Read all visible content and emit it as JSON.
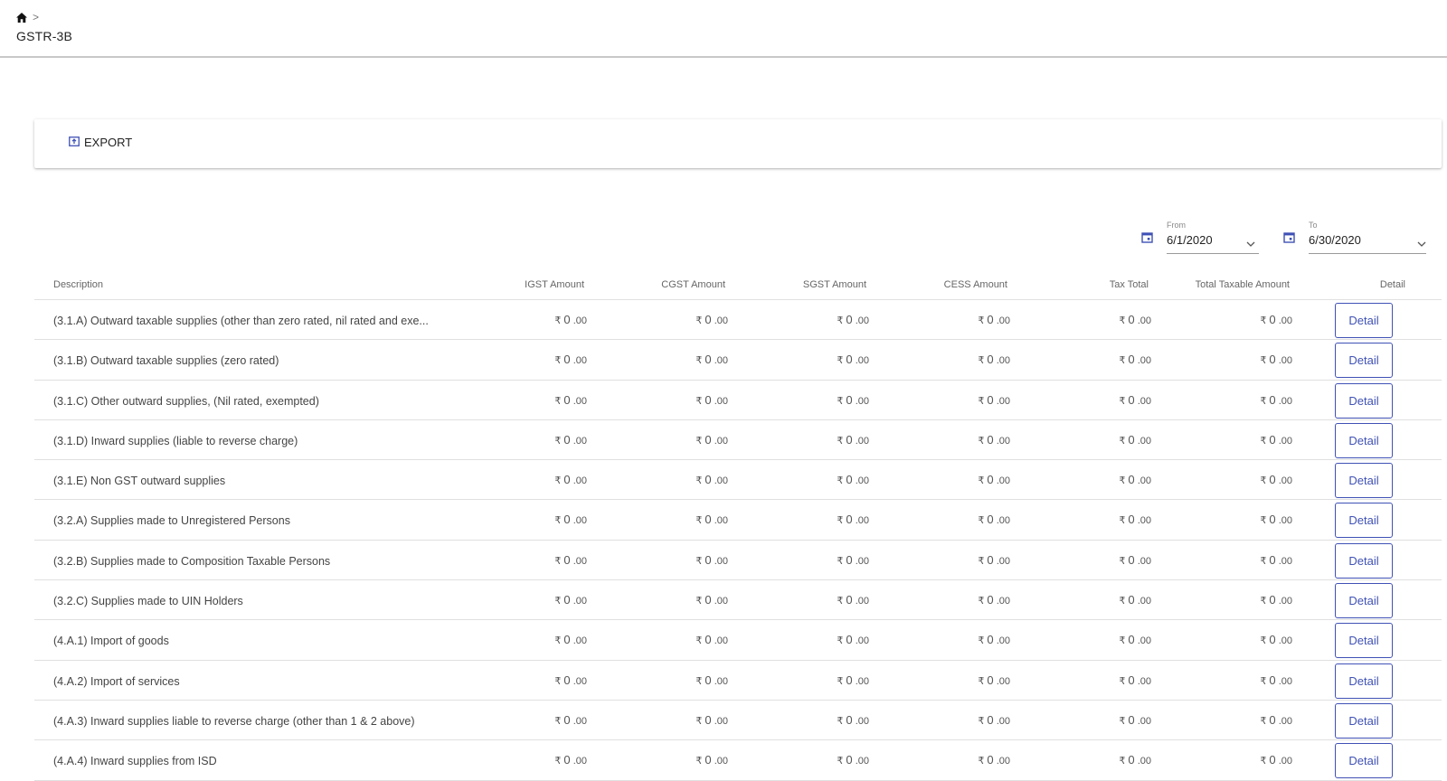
{
  "breadcrumb": {
    "separator": ">",
    "home_icon": "home-icon"
  },
  "page_title": "GSTR-3B",
  "toolbar": {
    "export_label": "EXPORT",
    "export_icon": "export-icon"
  },
  "filters": {
    "from": {
      "label": "From",
      "value": "6/1/2020"
    },
    "to": {
      "label": "To",
      "value": "6/30/2020"
    }
  },
  "table": {
    "columns": [
      "Description",
      "IGST Amount",
      "CGST Amount",
      "SGST Amount",
      "CESS Amount",
      "Tax Total",
      "Total Taxable Amount",
      "Detail"
    ],
    "currency_symbol": "₹",
    "detail_label": "Detail",
    "rows": [
      {
        "description": "(3.1.A) Outward taxable supplies (other than zero rated, nil rated and exe...",
        "amounts": [
          [
            "0",
            ".00"
          ],
          [
            "0",
            ".00"
          ],
          [
            "0",
            ".00"
          ],
          [
            "0",
            ".00"
          ],
          [
            "0",
            ".00"
          ],
          [
            "0",
            ".00"
          ]
        ]
      },
      {
        "description": "(3.1.B) Outward taxable supplies (zero rated)",
        "amounts": [
          [
            "0",
            ".00"
          ],
          [
            "0",
            ".00"
          ],
          [
            "0",
            ".00"
          ],
          [
            "0",
            ".00"
          ],
          [
            "0",
            ".00"
          ],
          [
            "0",
            ".00"
          ]
        ]
      },
      {
        "description": "(3.1.C) Other outward supplies, (Nil rated, exempted)",
        "amounts": [
          [
            "0",
            ".00"
          ],
          [
            "0",
            ".00"
          ],
          [
            "0",
            ".00"
          ],
          [
            "0",
            ".00"
          ],
          [
            "0",
            ".00"
          ],
          [
            "0",
            ".00"
          ]
        ]
      },
      {
        "description": "(3.1.D) Inward supplies (liable to reverse charge)",
        "amounts": [
          [
            "0",
            ".00"
          ],
          [
            "0",
            ".00"
          ],
          [
            "0",
            ".00"
          ],
          [
            "0",
            ".00"
          ],
          [
            "0",
            ".00"
          ],
          [
            "0",
            ".00"
          ]
        ]
      },
      {
        "description": "(3.1.E) Non GST outward supplies",
        "amounts": [
          [
            "0",
            ".00"
          ],
          [
            "0",
            ".00"
          ],
          [
            "0",
            ".00"
          ],
          [
            "0",
            ".00"
          ],
          [
            "0",
            ".00"
          ],
          [
            "0",
            ".00"
          ]
        ]
      },
      {
        "description": "(3.2.A) Supplies made to Unregistered Persons",
        "amounts": [
          [
            "0",
            ".00"
          ],
          [
            "0",
            ".00"
          ],
          [
            "0",
            ".00"
          ],
          [
            "0",
            ".00"
          ],
          [
            "0",
            ".00"
          ],
          [
            "0",
            ".00"
          ]
        ]
      },
      {
        "description": "(3.2.B) Supplies made to Composition Taxable Persons",
        "amounts": [
          [
            "0",
            ".00"
          ],
          [
            "0",
            ".00"
          ],
          [
            "0",
            ".00"
          ],
          [
            "0",
            ".00"
          ],
          [
            "0",
            ".00"
          ],
          [
            "0",
            ".00"
          ]
        ]
      },
      {
        "description": "(3.2.C) Supplies made to UIN Holders",
        "amounts": [
          [
            "0",
            ".00"
          ],
          [
            "0",
            ".00"
          ],
          [
            "0",
            ".00"
          ],
          [
            "0",
            ".00"
          ],
          [
            "0",
            ".00"
          ],
          [
            "0",
            ".00"
          ]
        ]
      },
      {
        "description": "(4.A.1) Import of goods",
        "amounts": [
          [
            "0",
            ".00"
          ],
          [
            "0",
            ".00"
          ],
          [
            "0",
            ".00"
          ],
          [
            "0",
            ".00"
          ],
          [
            "0",
            ".00"
          ],
          [
            "0",
            ".00"
          ]
        ]
      },
      {
        "description": "(4.A.2) Import of services",
        "amounts": [
          [
            "0",
            ".00"
          ],
          [
            "0",
            ".00"
          ],
          [
            "0",
            ".00"
          ],
          [
            "0",
            ".00"
          ],
          [
            "0",
            ".00"
          ],
          [
            "0",
            ".00"
          ]
        ]
      },
      {
        "description": "(4.A.3) Inward supplies liable to reverse charge (other than 1 & 2 above)",
        "amounts": [
          [
            "0",
            ".00"
          ],
          [
            "0",
            ".00"
          ],
          [
            "0",
            ".00"
          ],
          [
            "0",
            ".00"
          ],
          [
            "0",
            ".00"
          ],
          [
            "0",
            ".00"
          ]
        ]
      },
      {
        "description": "(4.A.4) Inward supplies from ISD",
        "amounts": [
          [
            "0",
            ".00"
          ],
          [
            "0",
            ".00"
          ],
          [
            "0",
            ".00"
          ],
          [
            "0",
            ".00"
          ],
          [
            "0",
            ".00"
          ],
          [
            "0",
            ".00"
          ]
        ]
      }
    ]
  },
  "colors": {
    "accent": "#3f51b5",
    "divider": "#e0e0e0"
  }
}
